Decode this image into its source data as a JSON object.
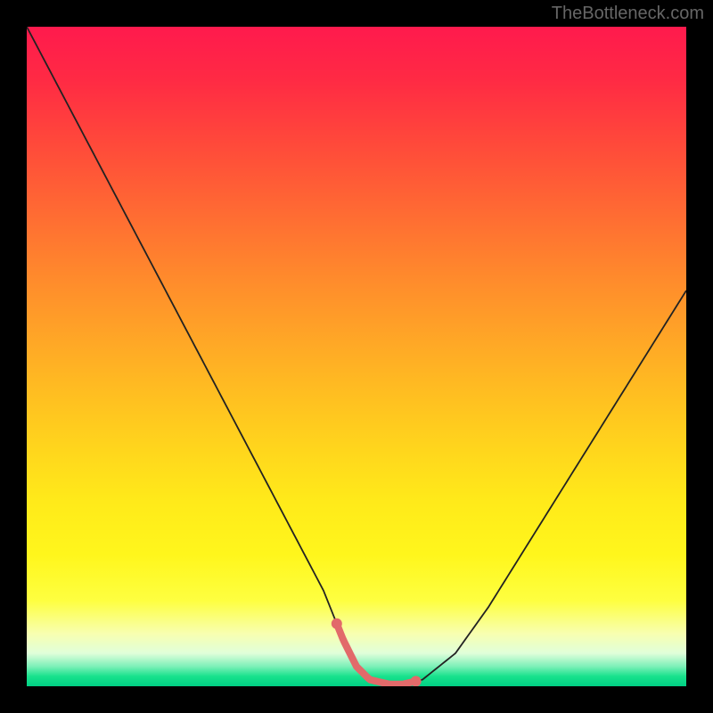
{
  "watermark": "TheBottleneck.com",
  "colors": {
    "background": "#000000",
    "gradient_top": "#ff1a4d",
    "gradient_bottom": "#00d084",
    "curve": "#222222",
    "highlight": "#e26a6a"
  },
  "chart_data": {
    "type": "line",
    "title": "",
    "xlabel": "",
    "ylabel": "",
    "xlim": [
      0,
      100
    ],
    "ylim": [
      0,
      100
    ],
    "x": [
      0,
      5,
      10,
      15,
      20,
      25,
      30,
      35,
      40,
      45,
      48,
      50,
      52,
      55,
      57,
      60,
      65,
      70,
      75,
      80,
      85,
      90,
      95,
      100
    ],
    "y": [
      100,
      90.5,
      81,
      71.5,
      62,
      52.5,
      43,
      33.5,
      24,
      14.5,
      7,
      3,
      1,
      0.3,
      0.3,
      1,
      5,
      12,
      20,
      28,
      36,
      44,
      52,
      60
    ],
    "highlight_range": {
      "x_start": 47,
      "x_end": 59
    },
    "grid": false,
    "legend": false,
    "annotations": []
  }
}
